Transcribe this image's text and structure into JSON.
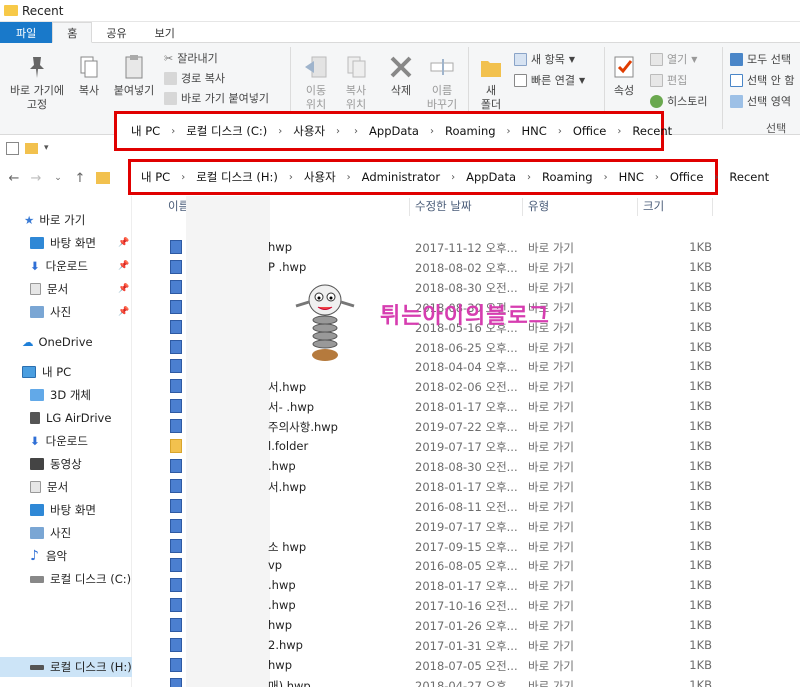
{
  "window": {
    "title": "Recent"
  },
  "tabs": [
    "파일",
    "홈",
    "공유",
    "보기"
  ],
  "ribbon": {
    "pin_label": "바로 가기에\n고정",
    "copy_label": "복사",
    "paste_label": "붙여넣기",
    "cut_label": "잘라내기",
    "copy_path_label": "경로 복사",
    "paste_shortcut_label": "바로 가기 붙여넣기",
    "move_label": "이동\n위치",
    "copy_to_label": "복사\n위치",
    "delete_label": "삭제",
    "rename_label": "이름\n바꾸기",
    "new_folder_label": "새\n폴더",
    "new_item_label": "새 항목",
    "easy_access_label": "빠른 연결",
    "properties_label": "속성",
    "open_label": "열기",
    "edit_label": "편집",
    "history_label": "히스토리",
    "select_all_label": "모두 선택",
    "select_none_label": "선택 안 함",
    "invert_label": "선택 영역",
    "select_group_label": "선택"
  },
  "path_c": {
    "crumbs": [
      "내 PC",
      "로컬 디스크 (C:)",
      "사용자",
      "",
      "AppData",
      "Roaming",
      "HNC",
      "Office",
      "Recent"
    ]
  },
  "path_h": {
    "crumbs": [
      "내 PC",
      "로컬 디스크 (H:)",
      "사용자",
      "Administrator",
      "AppData",
      "Roaming",
      "HNC",
      "Office",
      "Recent"
    ]
  },
  "sidebar": {
    "items": [
      {
        "label": "바로 가기",
        "icon": "star-icon"
      },
      {
        "label": "바탕 화면",
        "icon": "desktop-icon"
      },
      {
        "label": "다운로드",
        "icon": "download-icon"
      },
      {
        "label": "문서",
        "icon": "document-icon"
      },
      {
        "label": "사진",
        "icon": "picture-icon"
      },
      {
        "label": "OneDrive",
        "icon": "cloud-icon"
      },
      {
        "label": "내 PC",
        "icon": "pc-icon"
      },
      {
        "label": "3D 개체",
        "icon": "cube-icon"
      },
      {
        "label": "LG AirDrive",
        "icon": "drive-icon"
      },
      {
        "label": "다운로드",
        "icon": "download-icon"
      },
      {
        "label": "동영상",
        "icon": "video-icon"
      },
      {
        "label": "문서",
        "icon": "document-icon"
      },
      {
        "label": "바탕 화면",
        "icon": "desktop-icon"
      },
      {
        "label": "사진",
        "icon": "picture-icon"
      },
      {
        "label": "음악",
        "icon": "music-icon"
      },
      {
        "label": "로컬 디스크 (C:)",
        "icon": "disk-icon"
      },
      {
        "label": "로컬 디스크 (H:)",
        "icon": "disk-icon"
      }
    ]
  },
  "columns": {
    "name": "이름",
    "date": "수정한 날짜",
    "type": "유형",
    "size": "크기"
  },
  "files": [
    {
      "name": "hwp",
      "date": "2017-11-12 오후...",
      "type": "바로 가기",
      "size": "1KB",
      "folder": false
    },
    {
      "name": "P          .hwp",
      "date": "2018-08-02 오후...",
      "type": "바로 가기",
      "size": "1KB",
      "folder": false
    },
    {
      "name": "",
      "date": "2018-08-30 오전...",
      "type": "바로 가기",
      "size": "1KB",
      "folder": false
    },
    {
      "name": "",
      "date": "2018-08-30 오전...",
      "type": "바로 가기",
      "size": "1KB",
      "folder": false
    },
    {
      "name": "",
      "date": "2018-05-16 오후...",
      "type": "바로 가기",
      "size": "1KB",
      "folder": false
    },
    {
      "name": "",
      "date": "2018-06-25 오후...",
      "type": "바로 가기",
      "size": "1KB",
      "folder": false
    },
    {
      "name": "",
      "date": "2018-04-04 오후...",
      "type": "바로 가기",
      "size": "1KB",
      "folder": false
    },
    {
      "name": "서.hwp",
      "date": "2018-02-06 오전...",
      "type": "바로 가기",
      "size": "1KB",
      "folder": false
    },
    {
      "name": "서-          .hwp",
      "date": "2018-01-17 오후...",
      "type": "바로 가기",
      "size": "1KB",
      "folder": false
    },
    {
      "name": "주의사항.hwp",
      "date": "2019-07-22 오후...",
      "type": "바로 가기",
      "size": "1KB",
      "folder": false
    },
    {
      "name": "l.folder",
      "date": "2019-07-17 오후...",
      "type": "바로 가기",
      "size": "1KB",
      "folder": true
    },
    {
      "name": ".hwp",
      "date": "2018-08-30 오전...",
      "type": "바로 가기",
      "size": "1KB",
      "folder": false
    },
    {
      "name": "서.hwp",
      "date": "2018-01-17 오후...",
      "type": "바로 가기",
      "size": "1KB",
      "folder": false
    },
    {
      "name": "",
      "date": "2016-08-11 오전...",
      "type": "바로 가기",
      "size": "1KB",
      "folder": false
    },
    {
      "name": "",
      "date": "2019-07-17 오후...",
      "type": "바로 가기",
      "size": "1KB",
      "folder": false
    },
    {
      "name": "소          hwp",
      "date": "2017-09-15 오후...",
      "type": "바로 가기",
      "size": "1KB",
      "folder": false
    },
    {
      "name": "vp",
      "date": "2016-08-05 오후...",
      "type": "바로 가기",
      "size": "1KB",
      "folder": false
    },
    {
      "name": ".hwp",
      "date": "2018-01-17 오후...",
      "type": "바로 가기",
      "size": "1KB",
      "folder": false
    },
    {
      "name": ".hwp",
      "date": "2017-10-16 오전...",
      "type": "바로 가기",
      "size": "1KB",
      "folder": false
    },
    {
      "name": "hwp",
      "date": "2017-01-26 오후...",
      "type": "바로 가기",
      "size": "1KB",
      "folder": false
    },
    {
      "name": "2.hwp",
      "date": "2017-01-31 오후...",
      "type": "바로 가기",
      "size": "1KB",
      "folder": false
    },
    {
      "name": "hwp",
      "date": "2018-07-05 오전...",
      "type": "바로 가기",
      "size": "1KB",
      "folder": false
    },
    {
      "name": "매).hwp",
      "date": "2018-04-27 오후...",
      "type": "바로 가기",
      "size": "1KB",
      "folder": false
    }
  ],
  "watermark": "튀는아이의블로그"
}
